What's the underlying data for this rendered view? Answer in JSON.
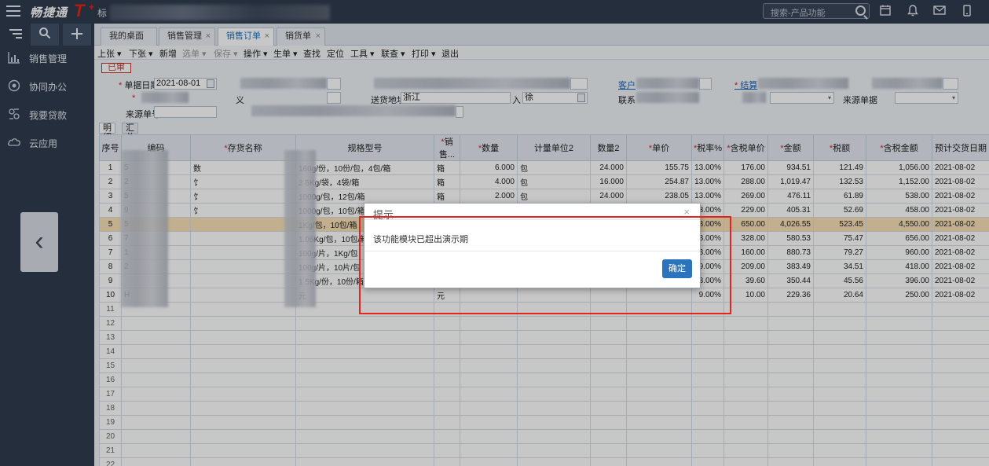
{
  "app": {
    "logo_text": "畅捷通",
    "logo_t": "T",
    "logo_plus": "+",
    "logo_suffix": "标",
    "search_placeholder": "搜索-产品功能"
  },
  "nav": {
    "items": [
      {
        "label": "销售管理",
        "icon": "chart-icon"
      },
      {
        "label": "协同办公",
        "icon": "collab-icon"
      },
      {
        "label": "我要贷款",
        "icon": "loan-icon"
      },
      {
        "label": "云应用",
        "icon": "cloud-icon"
      }
    ],
    "back_glyph": "‹"
  },
  "tabs": [
    {
      "label": "我的桌面",
      "closable": false
    },
    {
      "label": "销售管理",
      "closable": true
    },
    {
      "label": "销售订单",
      "closable": true,
      "active": true
    },
    {
      "label": "销货单",
      "closable": true
    }
  ],
  "toolbar": {
    "up": "上张",
    "down": "下张",
    "new": "新增",
    "choose": "选单",
    "save": "保存",
    "ops": "操作",
    "generate": "生单",
    "find": "查找",
    "locate": "定位",
    "tools": "工具",
    "linkquery": "联查",
    "print": "打印",
    "exit": "退出"
  },
  "form": {
    "status": "已审",
    "date_label": "单据日期",
    "date_value": "2021-08-01",
    "address_label": "送货地址",
    "address_value": "浙江",
    "customer_label": "客户",
    "settle_label": "结算",
    "contact_label": "联系",
    "source_type_label": "来源单据",
    "source_no_label": "来源单号",
    "in_label": "入",
    "in_value": "徐",
    "prefix_label": "义"
  },
  "grid_tabs": [
    "明细",
    "汇总"
  ],
  "grid": {
    "headers": [
      "序号",
      "编码",
      "存货名称",
      "规格型号",
      "销售...",
      "数量",
      "计量单位2",
      "数量2",
      "单价",
      "税率%",
      "含税单价",
      "金额",
      "税额",
      "含税金额",
      "预计交货日期"
    ],
    "required_cols": [
      2,
      4,
      5,
      8,
      9,
      10,
      11,
      12,
      13
    ],
    "rows": [
      {
        "no": "1",
        "code": "5",
        "name": "数",
        "spec": "160g/份，10份/包，4包/箱",
        "unit": "箱",
        "qty": "6.000",
        "unit2": "包",
        "qty2": "24.000",
        "price": "155.75",
        "tax": "13.00%",
        "taxprice": "176.00",
        "amount": "934.51",
        "taxamt": "121.49",
        "total": "1,056.00",
        "date": "2021-08-02"
      },
      {
        "no": "2",
        "code": "2",
        "name": "饣",
        "spec": "2.5Kg/袋，4袋/箱",
        "unit": "箱",
        "qty": "4.000",
        "unit2": "包",
        "qty2": "16.000",
        "price": "254.87",
        "tax": "13.00%",
        "taxprice": "288.00",
        "amount": "1,019.47",
        "taxamt": "132.53",
        "total": "1,152.00",
        "date": "2021-08-02"
      },
      {
        "no": "3",
        "code": "5",
        "name": "饣",
        "spec": "1000g/包，12包/箱",
        "unit": "箱",
        "qty": "2.000",
        "unit2": "包",
        "qty2": "24.000",
        "price": "238.05",
        "tax": "13.00%",
        "taxprice": "269.00",
        "amount": "476.11",
        "taxamt": "61.89",
        "total": "538.00",
        "date": "2021-08-02"
      },
      {
        "no": "4",
        "code": "9",
        "name": "饣",
        "spec": "1000g/包，10包/箱",
        "unit": "箱",
        "qty": "2.000",
        "unit2": "包",
        "qty2": "20.000",
        "price": "202.65",
        "tax": "13.00%",
        "taxprice": "229.00",
        "amount": "405.31",
        "taxamt": "52.69",
        "total": "458.00",
        "date": "2021-08-02"
      },
      {
        "no": "5",
        "code": "5",
        "name": "",
        "spec": "1Kg/包，10包/箱",
        "unit": "",
        "qty": "",
        "unit2": "",
        "qty2": "",
        "price": "",
        "tax": "13.00%",
        "taxprice": "650.00",
        "amount": "4,026.55",
        "taxamt": "523.45",
        "total": "4,550.00",
        "date": "2021-08-02",
        "selected": true
      },
      {
        "no": "6",
        "code": "7",
        "name": "",
        "spec": "1.05Kg/包，10包/箱",
        "unit": "",
        "qty": "",
        "unit2": "",
        "qty2": "",
        "price": "",
        "tax": "13.00%",
        "taxprice": "328.00",
        "amount": "580.53",
        "taxamt": "75.47",
        "total": "656.00",
        "date": "2021-08-02"
      },
      {
        "no": "7",
        "code": "1",
        "name": "",
        "spec": "100g/片，1Kg/包",
        "unit": "",
        "qty": "",
        "unit2": "",
        "qty2": "",
        "price": "",
        "tax": "13.00%",
        "taxprice": "160.00",
        "amount": "880.73",
        "taxamt": "79.27",
        "total": "960.00",
        "date": "2021-08-02"
      },
      {
        "no": "8",
        "code": "2",
        "name": "",
        "spec": "100g/片，10片/包",
        "unit": "",
        "qty": "",
        "unit2": "",
        "qty2": "",
        "price": "",
        "tax": "9.00%",
        "taxprice": "209.00",
        "amount": "383.49",
        "taxamt": "34.51",
        "total": "418.00",
        "date": "2021-08-02"
      },
      {
        "no": "9",
        "code": "",
        "name": "",
        "spec": "1.5Kg/份，10份/箱",
        "unit": "",
        "qty": "",
        "unit2": "",
        "qty2": "",
        "price": "",
        "tax": "13.00%",
        "taxprice": "39.60",
        "amount": "350.44",
        "taxamt": "45.56",
        "total": "396.00",
        "date": "2021-08-02"
      },
      {
        "no": "10",
        "code": "H",
        "name": "",
        "spec": "元",
        "unit": "元",
        "qty": "",
        "unit2": "",
        "qty2": "",
        "price": "",
        "tax": "9.00%",
        "taxprice": "10.00",
        "amount": "229.36",
        "taxamt": "20.64",
        "total": "250.00",
        "date": "2021-08-02"
      }
    ],
    "empty_rows": [
      "11",
      "12",
      "13",
      "14",
      "15",
      "16",
      "17",
      "18",
      "19",
      "20",
      "21",
      "22"
    ]
  },
  "dialog": {
    "title": "提示",
    "message": "该功能模块已超出演示期",
    "ok_label": "确定",
    "close_glyph": "×"
  },
  "colors": {
    "nav_bg": "#2f3b4d",
    "accent": "#2b73bd",
    "highlight_border": "#e6231e",
    "selected_row": "#f8e1b5"
  }
}
